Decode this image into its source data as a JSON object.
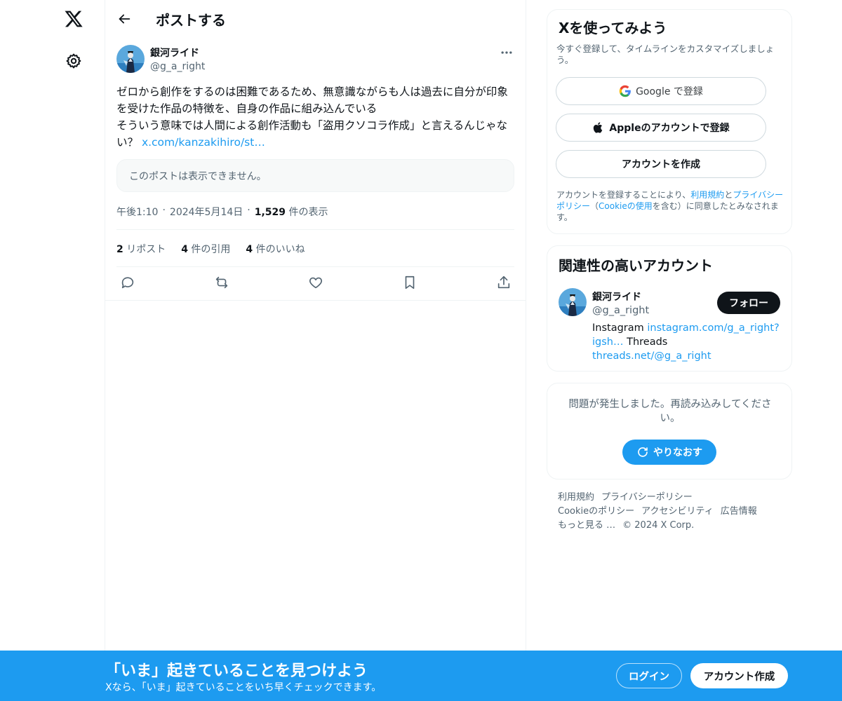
{
  "nav": {
    "logo_icon": "x-logo-icon",
    "settings_icon": "gear-icon"
  },
  "header": {
    "back_icon": "arrow-left-icon",
    "title": "ポストする"
  },
  "post": {
    "author_name": "銀河ライド",
    "author_handle": "@g_a_right",
    "more_icon": "more-horizontal-icon",
    "text": "ゼロから創作をするのは困難であるため、無意識ながらも人は過去に自分が印象を受けた作品の特徴を、自身の作品に組み込んでいる\nそういう意味では人間による創作活動も「盗用クソコラ作成」と言えるんじゃない？ ",
    "link": "x.com/kanzakihiro/st…",
    "quote_unavailable": "このポストは表示できません。",
    "time": "午後1:10",
    "date": "2024年5月14日",
    "sep": "·",
    "views": "1,529",
    "views_label": "件の表示",
    "reposts": "2",
    "reposts_label": "リポスト",
    "quotes": "4",
    "quotes_label": "件の引用",
    "likes": "4",
    "likes_label": "件のいいね"
  },
  "signup_card": {
    "title": "Xを使ってみよう",
    "subtitle": "今すぐ登録して、タイムラインをカスタマイズしましょう。",
    "google_button": "Google で登録",
    "apple_button": "Appleのアカウントで登録",
    "create_button": "アカウントを作成",
    "legal_prefix": "アカウントを登録することにより、",
    "legal_terms": "利用規約",
    "legal_and": "と",
    "legal_privacy": "プライバシーポリシー",
    "legal_paren_open": "（",
    "legal_cookie": "Cookieの使用",
    "legal_suffix": "を含む）に同意したとみなされます。"
  },
  "related": {
    "title": "関連性の高いアカウント",
    "name": "銀河ライド",
    "handle": "@g_a_right",
    "follow_button": "フォロー",
    "bio_prefix": "Instagram ",
    "bio_link1": "instagram.com/g_a_right?igsh…",
    "bio_mid": " Threads ",
    "bio_link2": "threads.net/@g_a_right"
  },
  "error_card": {
    "message": "問題が発生しました。再読み込みしてください。",
    "retry_button": "やりなおす",
    "retry_icon": "refresh-icon"
  },
  "footer": {
    "links": [
      "利用規約",
      "プライバシーポリシー",
      "Cookieのポリシー",
      "アクセシビリティ",
      "広告情報",
      "もっと見る …",
      "© 2024 X Corp."
    ]
  },
  "banner": {
    "title": "「いま」起きていることを見つけよう",
    "subtitle": "Xなら、「いま」起きていることをいち早くチェックできます。",
    "login_button": "ログイン",
    "signup_button": "アカウント作成"
  },
  "colors": {
    "accent": "#1d9bf0",
    "text_primary": "#0f1419",
    "text_secondary": "#536471",
    "border": "#eff3f4"
  }
}
